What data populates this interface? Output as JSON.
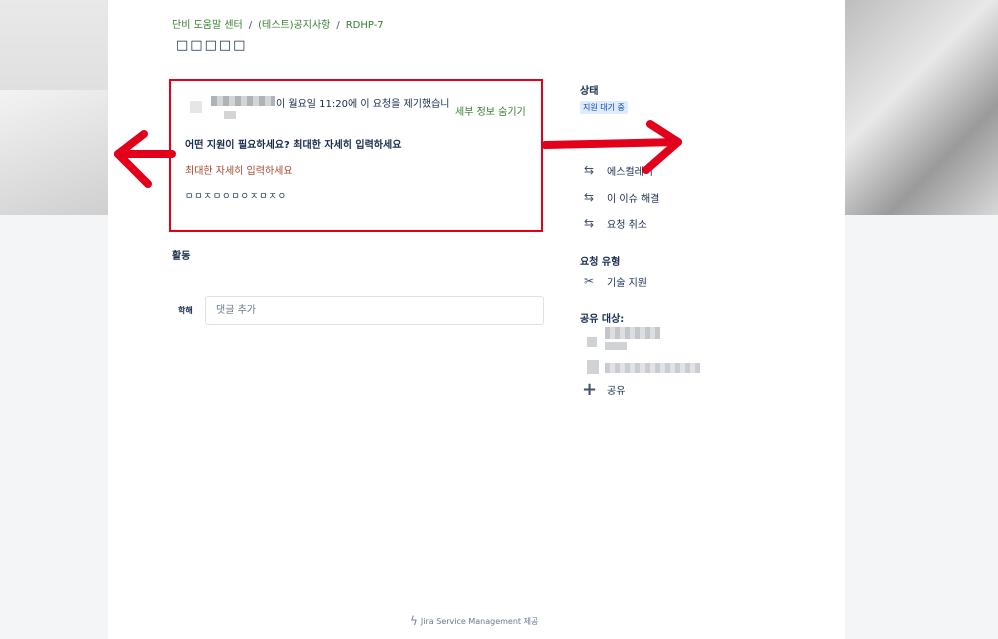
{
  "breadcrumb": {
    "items": [
      "단비 도움말 센터",
      "(테스트)공지사항",
      "RDHP-7"
    ],
    "separator": "/"
  },
  "request": {
    "title": "□□□□□",
    "raised_text": "이 월요일 11:20에 이 요청을 제기했습니",
    "hide_details": "세부 정보 숨기기",
    "question_label": "어떤 지원이 필요하세요? 최대한 자세히 입력하세요",
    "help_text": "최대한 자세히 입력하세요",
    "answer": "ㅁㅁㅈㅁㅇㅁㅇㅈㅁㅈㅇ"
  },
  "activity": {
    "heading": "활동",
    "commenter": "학해",
    "comment_placeholder": "댓글 추가"
  },
  "sidebar": {
    "status_heading": "상태",
    "status_value": "지원 대기 중",
    "actions": [
      "에스컬레이",
      "이 이슈 해결",
      "요청 취소"
    ],
    "request_type_heading": "요청 유형",
    "request_type": "기술 지원",
    "share_heading": "공유 대상:",
    "share_label": "공유"
  },
  "footer": {
    "powered_by": "Jira Service Management 제공"
  },
  "colors": {
    "brand_green": "#357d2e",
    "highlight_red": "#e3001b",
    "help_text": "#a3462c"
  },
  "icons": {
    "transition": "transition-arrows-icon",
    "request_type": "tools-icon",
    "share": "plus-icon",
    "footer": "lightning-bolt-icon"
  }
}
